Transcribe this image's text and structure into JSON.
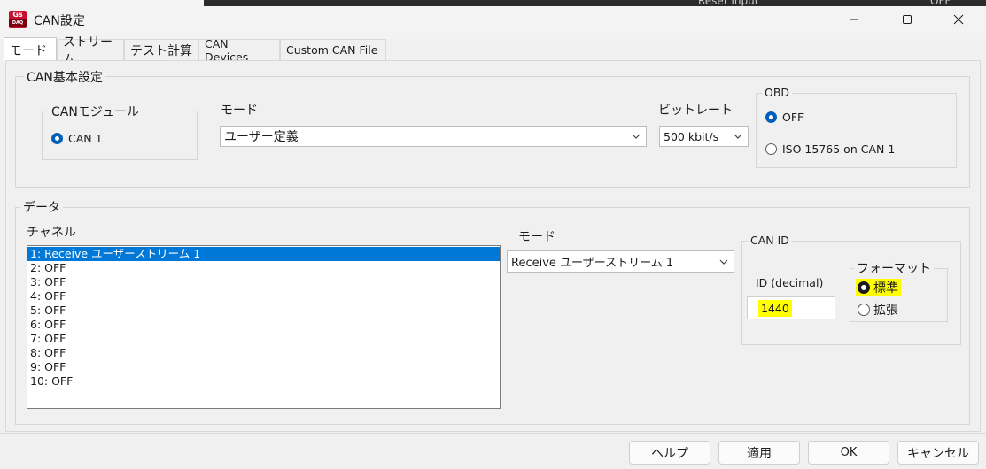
{
  "window": {
    "title": "CAN設定",
    "icon_text": "Gs",
    "icon_sub": "DAQ",
    "bg_text_1": "Reset Input",
    "bg_text_2": "OFF",
    "controls": [
      "minimize-icon",
      "maximize-icon",
      "close-icon"
    ]
  },
  "tabs": [
    {
      "label": "モード",
      "active": true
    },
    {
      "label": "ストリーム",
      "active": false
    },
    {
      "label": "テスト計算",
      "active": false
    },
    {
      "label": "CAN Devices",
      "active": false
    },
    {
      "label": "Custom CAN File",
      "active": false
    }
  ],
  "can_basic": {
    "legend": "CAN基本設定",
    "module": {
      "legend": "CANモジュール",
      "option": "CAN 1",
      "selected": true
    },
    "mode_label": "モード",
    "mode_value": "ユーザー定義",
    "bitrate_label": "ビットレート",
    "bitrate_value": "500 kbit/s",
    "obd": {
      "legend": "OBD",
      "options": [
        {
          "label": "OFF",
          "selected": true
        },
        {
          "label": "ISO 15765 on CAN 1",
          "selected": false
        }
      ]
    }
  },
  "data": {
    "legend": "データ",
    "channel_label": "チャネル",
    "channels": [
      "1: Receive ユーザーストリーム 1",
      "2: OFF",
      "3: OFF",
      "4: OFF",
      "5: OFF",
      "6: OFF",
      "7: OFF",
      "8: OFF",
      "9: OFF",
      "10: OFF"
    ],
    "selected_channel_index": 0,
    "mode_label": "モード",
    "mode_value": "Receive ユーザーストリーム 1",
    "can_id": {
      "legend": "CAN ID",
      "id_label": "ID (decimal)",
      "id_value": "1440",
      "format": {
        "legend": "フォーマット",
        "options": [
          {
            "label": "標準",
            "selected": true
          },
          {
            "label": "拡張",
            "selected": false
          }
        ]
      }
    }
  },
  "footer": {
    "help": "ヘルプ",
    "apply": "適用",
    "ok": "OK",
    "cancel": "キャンセル"
  },
  "colors": {
    "accent": "#005fb8",
    "selection": "#0078d7",
    "highlight": "#ffff00"
  }
}
